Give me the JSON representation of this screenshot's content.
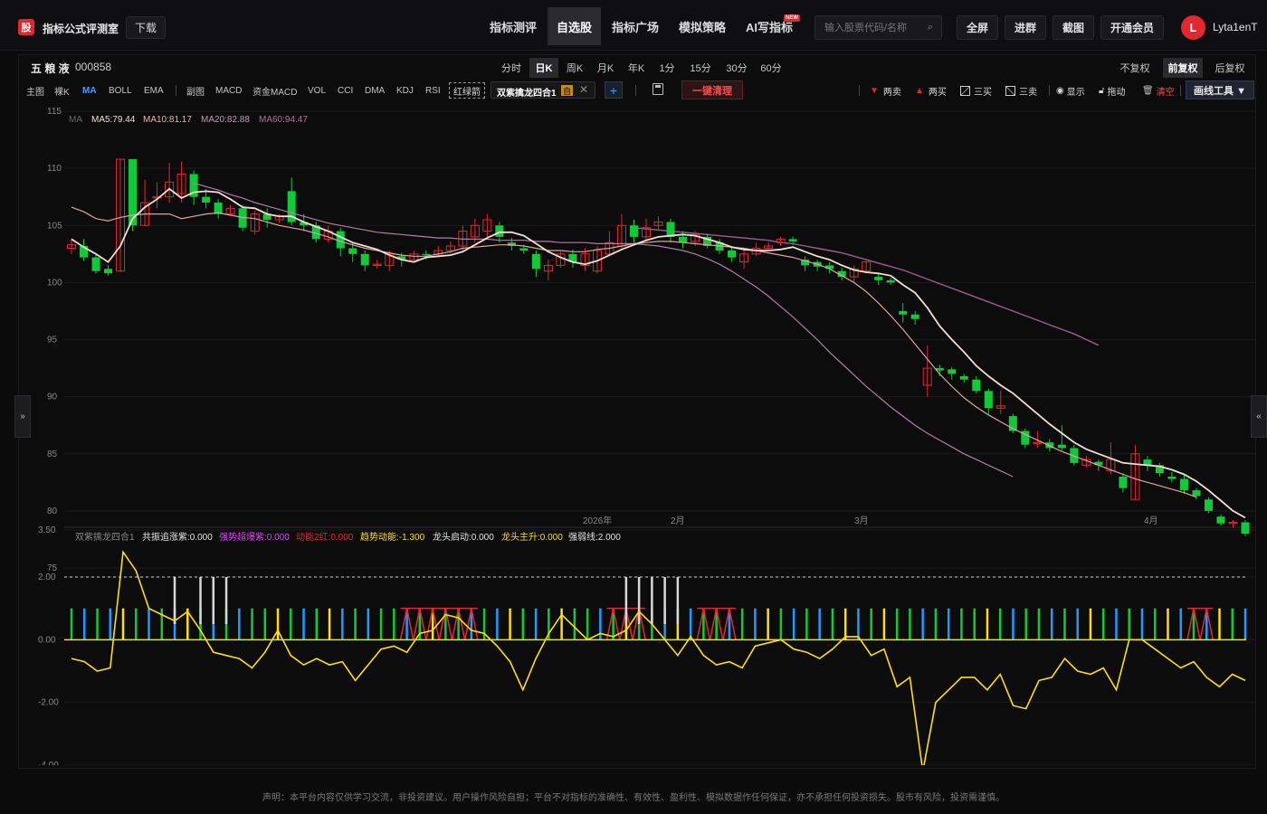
{
  "app": {
    "logo_char": "股",
    "name": "指标公式评测室",
    "download_label": "下载"
  },
  "nav": [
    {
      "label": "指标测评",
      "active": false
    },
    {
      "label": "自选股",
      "active": true
    },
    {
      "label": "指标广场",
      "active": false
    },
    {
      "label": "模拟策略",
      "active": false
    },
    {
      "label": "AI写指标",
      "active": false,
      "badge": "NEW"
    }
  ],
  "search": {
    "placeholder": "输入股票代码/名称",
    "value": ""
  },
  "top_buttons": [
    "全屏",
    "进群",
    "截图",
    "开通会员"
  ],
  "user": {
    "avatar_letter": "L",
    "name": "Lyta1enT"
  },
  "stock": {
    "name": "五 粮 液",
    "code": "000858"
  },
  "periods": [
    "分时",
    "日K",
    "周K",
    "月K",
    "年K",
    "1分",
    "15分",
    "30分",
    "60分"
  ],
  "active_period": "日K",
  "adjust": [
    "不复权",
    "前复权",
    "后复权"
  ],
  "active_adjust": "前复权",
  "main_tabs": [
    "主图",
    "裸K",
    "MA",
    "BOLL",
    "EMA"
  ],
  "sub_tabs": [
    "副图",
    "MACD",
    "资金MACD",
    "VOL",
    "CCI",
    "DMA",
    "KDJ",
    "RSI"
  ],
  "red_green_arrow": "红绿箭",
  "indicator_tag": {
    "name": "双紫擒龙四合1",
    "badge": "自"
  },
  "one_click_clear": "一键清理",
  "draw_options": [
    "两卖",
    "两买",
    "三买",
    "三卖",
    "显示",
    "拖动",
    "清空"
  ],
  "draw_tools_label": "画线工具 ▼",
  "ma_legend": {
    "label": "MA",
    "ma5": "MA5:79.44",
    "ma10": "MA10:81.17",
    "ma20": "MA20:82.88",
    "ma60": "MA60:94.47"
  },
  "sub_legend": {
    "name": "双紫擒龙四合1",
    "items": [
      "共振追涨紫:0.000",
      "强势超爆紫:0.000",
      "动能2红:0.000",
      "趋势动能:-1.300",
      "龙头启动:0.000",
      "龙头主升:0.000",
      "强弱线:2.000"
    ]
  },
  "time_labels": [
    "2026年",
    "2月",
    "3月",
    "4月"
  ],
  "disclaimer": "声明：本平台内容仅供学习交流，非投资建议。用户操作风险自担；平台不对指标的准确性、有效性、盈利性、模拟数据作任何保证，亦不承担任何投资损失。股市有风险，投资需谨慎。",
  "colors": {
    "up": "#e3262f",
    "down": "#12c93a",
    "ma5": "#f0ddd4",
    "ma10": "#d8a6a0",
    "ma20": "#b07ea2",
    "ma60": "#9a5f8c",
    "trend": "#ffe000",
    "accent": "#4a9cff"
  },
  "chart_data": [
    {
      "type": "candlestick",
      "y_ticks": [
        115,
        110,
        105,
        100,
        95,
        90,
        85,
        80,
        75
      ],
      "ylim": [
        75,
        115
      ],
      "x_labels": [
        "2026年",
        "2月",
        "3月",
        "4月"
      ],
      "candles": [
        [
          103.0,
          103.3,
          103.8,
          102.5
        ],
        [
          103.2,
          102.2,
          103.8,
          101.9
        ],
        [
          102.2,
          101.0,
          102.5,
          100.8
        ],
        [
          101.2,
          100.8,
          101.5,
          100.6
        ],
        [
          101.0,
          110.8,
          110.8,
          100.9
        ],
        [
          110.8,
          105.0,
          110.8,
          104.5
        ],
        [
          105.0,
          107.0,
          109.0,
          105.0
        ],
        [
          107.5,
          107.5,
          108.8,
          106.5
        ],
        [
          107.5,
          108.8,
          110.5,
          107.0
        ],
        [
          107.8,
          109.5,
          110.6,
          107.0
        ],
        [
          109.5,
          107.5,
          109.8,
          106.8
        ],
        [
          107.5,
          107.0,
          108.2,
          106.5
        ],
        [
          107.0,
          106.0,
          107.3,
          105.6
        ],
        [
          106.0,
          106.5,
          106.8,
          105.8
        ],
        [
          106.5,
          104.8,
          106.8,
          104.5
        ],
        [
          104.5,
          106.0,
          106.3,
          104.2
        ],
        [
          106.0,
          105.5,
          106.5,
          104.8
        ],
        [
          105.5,
          105.8,
          106.0,
          105.2
        ],
        [
          108.0,
          105.3,
          109.2,
          105.0
        ],
        [
          105.3,
          105.0,
          106.0,
          104.5
        ],
        [
          105.0,
          103.8,
          105.3,
          103.5
        ],
        [
          103.8,
          104.5,
          105.0,
          103.5
        ],
        [
          104.5,
          103.0,
          104.8,
          102.3
        ],
        [
          103.0,
          102.5,
          103.5,
          101.8
        ],
        [
          102.5,
          101.5,
          102.8,
          101.0
        ],
        [
          101.5,
          101.6,
          102.0,
          101.2
        ],
        [
          101.5,
          102.5,
          102.8,
          101.0
        ],
        [
          102.3,
          102.0,
          102.6,
          101.4
        ],
        [
          102.0,
          102.5,
          102.8,
          101.8
        ],
        [
          102.5,
          102.4,
          102.8,
          102.0
        ],
        [
          102.5,
          102.8,
          103.2,
          102.2
        ],
        [
          102.8,
          103.2,
          103.6,
          102.5
        ],
        [
          103.2,
          104.5,
          105.0,
          102.8
        ],
        [
          104.0,
          105.0,
          105.6,
          103.5
        ],
        [
          104.5,
          105.5,
          106.0,
          104.0
        ],
        [
          105.0,
          104.0,
          105.3,
          103.5
        ],
        [
          103.5,
          103.2,
          103.9,
          102.8
        ],
        [
          103.0,
          102.8,
          103.3,
          102.5
        ],
        [
          102.5,
          101.2,
          102.8,
          100.5
        ],
        [
          101.0,
          101.5,
          102.0,
          100.2
        ],
        [
          101.5,
          102.5,
          102.7,
          101.3
        ],
        [
          102.5,
          101.8,
          102.9,
          101.3
        ],
        [
          101.5,
          102.5,
          103.0,
          101.0
        ],
        [
          101.0,
          102.8,
          103.2,
          100.8
        ],
        [
          102.5,
          103.5,
          104.5,
          102.3
        ],
        [
          103.2,
          105.0,
          106.0,
          103.0
        ],
        [
          105.0,
          104.0,
          105.5,
          103.5
        ],
        [
          104.0,
          104.8,
          105.6,
          103.6
        ],
        [
          105.0,
          105.3,
          105.8,
          104.5
        ],
        [
          105.3,
          104.0,
          105.6,
          103.5
        ],
        [
          104.0,
          103.5,
          104.5,
          103.0
        ],
        [
          103.6,
          104.2,
          104.5,
          103.2
        ],
        [
          104.0,
          103.2,
          104.3,
          103.0
        ],
        [
          103.5,
          102.8,
          103.8,
          102.5
        ],
        [
          102.8,
          102.2,
          103.2,
          101.8
        ],
        [
          101.8,
          102.5,
          103.0,
          101.2
        ],
        [
          102.5,
          103.0,
          103.5,
          102.3
        ],
        [
          103.0,
          103.2,
          103.5,
          102.8
        ],
        [
          103.5,
          103.8,
          104.0,
          103.2
        ],
        [
          103.8,
          103.6,
          104.0,
          103.3
        ],
        [
          102.0,
          101.5,
          102.3,
          101.0
        ],
        [
          101.8,
          101.4,
          102.0,
          101.0
        ],
        [
          101.5,
          101.2,
          101.8,
          100.8
        ],
        [
          101.0,
          100.5,
          101.3,
          100.2
        ],
        [
          100.5,
          101.2,
          101.5,
          100.0
        ],
        [
          101.0,
          101.8,
          102.0,
          100.8
        ],
        [
          100.5,
          100.2,
          100.8,
          99.8
        ],
        [
          100.2,
          100.0,
          100.4,
          99.8
        ],
        [
          97.5,
          97.2,
          98.2,
          96.5
        ],
        [
          97.2,
          96.8,
          97.5,
          96.3
        ],
        [
          91.0,
          92.5,
          94.5,
          90.0
        ],
        [
          92.5,
          92.3,
          92.8,
          91.8
        ],
        [
          92.4,
          92.0,
          92.6,
          91.5
        ],
        [
          91.8,
          91.5,
          92.0,
          91.2
        ],
        [
          91.5,
          90.5,
          91.8,
          90.3
        ],
        [
          90.5,
          89.0,
          90.7,
          88.5
        ],
        [
          89.0,
          89.2,
          90.5,
          88.5
        ],
        [
          88.3,
          87.0,
          88.5,
          86.8
        ],
        [
          87.0,
          85.8,
          87.2,
          85.5
        ],
        [
          86.0,
          86.0,
          87.0,
          85.5
        ],
        [
          86.0,
          85.5,
          86.3,
          85.2
        ],
        [
          85.8,
          85.5,
          87.5,
          85.3
        ],
        [
          85.5,
          84.2,
          85.8,
          84.0
        ],
        [
          84.0,
          84.5,
          84.8,
          83.8
        ],
        [
          84.3,
          84.0,
          84.5,
          83.5
        ],
        [
          83.5,
          84.5,
          86.0,
          83.2
        ],
        [
          83.0,
          82.0,
          83.3,
          81.6
        ],
        [
          81.0,
          85.0,
          85.8,
          81.0
        ],
        [
          84.5,
          84.0,
          84.8,
          83.5
        ],
        [
          84.0,
          83.3,
          84.2,
          83.0
        ],
        [
          83.0,
          82.8,
          83.4,
          82.5
        ],
        [
          82.8,
          81.8,
          83.2,
          81.5
        ],
        [
          81.8,
          81.3,
          82.0,
          81.0
        ],
        [
          81.0,
          80.0,
          81.2,
          79.8
        ],
        [
          79.5,
          78.9,
          79.7,
          78.7
        ],
        [
          78.9,
          79.0,
          79.2,
          78.5
        ],
        [
          79.0,
          78.0,
          79.2,
          77.8
        ]
      ],
      "ma5": [
        103.8,
        103.1,
        102.5,
        101.8,
        103.2,
        105.6,
        106.6,
        107.3,
        108.2,
        107.4,
        107.9,
        108.0,
        107.9,
        107.3,
        106.6,
        106.5,
        106.0,
        105.8,
        105.8,
        105.3,
        104.9,
        104.5,
        104.0,
        103.5,
        103.2,
        102.9,
        102.4,
        102.0,
        101.8,
        102.2,
        102.3,
        102.4,
        102.7,
        103.3,
        103.9,
        104.4,
        104.4,
        104.1,
        103.4,
        102.7,
        102.2,
        101.8,
        101.6,
        101.9,
        102.4,
        102.9,
        103.3,
        103.7,
        104.0,
        104.1,
        104.2,
        104.1,
        103.8,
        103.5,
        103.1,
        102.9,
        102.8,
        102.8,
        102.9,
        103.1,
        102.7,
        102.3,
        102.0,
        101.5,
        101.1,
        100.9,
        100.8,
        100.6,
        99.8,
        99.1,
        97.8,
        96.2,
        95.0,
        93.9,
        92.7,
        91.8,
        91.0,
        90.3,
        89.4,
        88.5,
        87.6,
        86.8,
        86.0,
        85.4,
        85.0,
        84.6,
        84.2,
        84.1,
        84.0,
        83.9,
        83.6,
        83.2,
        82.6,
        81.8,
        80.9,
        80.0,
        79.4
      ],
      "ma10": [
        106.6,
        106.2,
        105.6,
        105.4,
        105.7,
        105.9,
        106.0,
        106.0,
        106.0,
        105.6,
        105.8,
        106.0,
        106.1,
        105.9,
        105.7,
        105.6,
        105.3,
        105.0,
        104.8,
        104.6,
        104.3,
        104.0,
        103.6,
        103.3,
        103.0,
        102.8,
        102.6,
        102.4,
        102.3,
        102.3,
        102.5,
        102.7,
        103.0,
        103.1,
        103.2,
        103.3,
        103.3,
        103.2,
        103.0,
        102.8,
        102.8,
        102.7,
        102.7,
        102.9,
        103.0,
        103.2,
        103.4,
        103.5,
        103.6,
        103.6,
        103.5,
        103.4,
        103.3,
        103.2,
        103.1,
        103.0,
        102.8,
        102.6,
        102.4,
        102.2,
        101.9,
        101.6,
        101.2,
        100.6,
        100.0,
        99.2,
        98.2,
        97.1,
        95.9,
        94.6,
        93.3,
        92.0,
        90.9,
        89.9,
        89.1,
        88.4,
        87.8,
        87.2,
        86.7,
        86.2,
        85.7,
        85.2,
        84.8,
        84.4,
        84.0,
        83.6,
        83.2,
        82.8,
        82.5,
        82.2,
        81.9,
        81.6,
        81.2
      ],
      "ma20": [
        null,
        null,
        null,
        null,
        null,
        null,
        null,
        null,
        null,
        null,
        108.7,
        108.4,
        108.1,
        107.7,
        107.4,
        107.0,
        106.7,
        106.4,
        106.1,
        105.8,
        105.5,
        105.2,
        105.0,
        104.8,
        104.6,
        104.4,
        104.3,
        104.2,
        104.1,
        104.0,
        103.9,
        103.9,
        103.8,
        103.8,
        103.8,
        103.7,
        103.7,
        103.7,
        103.6,
        103.6,
        103.5,
        103.5,
        103.5,
        103.4,
        103.4,
        103.4,
        103.4,
        103.3,
        103.2,
        103.0,
        102.8,
        102.5,
        102.1,
        101.6,
        101.0,
        100.3,
        99.6,
        98.8,
        97.9,
        97.0,
        96.0,
        95.0,
        93.9,
        92.9,
        91.9,
        90.9,
        90.0,
        89.1,
        88.3,
        87.5,
        86.8,
        86.2,
        85.6,
        85.0,
        84.5,
        84.0,
        83.5,
        83.0
      ],
      "ma60": [
        null,
        null,
        null,
        null,
        null,
        null,
        null,
        null,
        null,
        null,
        null,
        null,
        null,
        null,
        null,
        null,
        null,
        null,
        null,
        null,
        null,
        null,
        null,
        null,
        null,
        null,
        null,
        null,
        null,
        null,
        null,
        null,
        null,
        null,
        null,
        null,
        null,
        null,
        null,
        null,
        null,
        null,
        null,
        null,
        null,
        null,
        104.8,
        104.7,
        104.6,
        104.5,
        104.4,
        104.3,
        104.2,
        104.1,
        104.0,
        103.9,
        103.8,
        103.7,
        103.5,
        103.4,
        103.2,
        103.0,
        102.8,
        102.6,
        102.3,
        102.0,
        101.7,
        101.4,
        101.1,
        100.7,
        100.3,
        99.9,
        99.5,
        99.1,
        98.7,
        98.3,
        97.9,
        97.5,
        97.1,
        96.7,
        96.3,
        95.9,
        95.5,
        95.0,
        94.5
      ]
    },
    {
      "type": "bar+line",
      "y_ticks": [
        3.5,
        2.0,
        0.0,
        -2.0,
        -4.0,
        -5.5
      ],
      "ylim": [
        -5.5,
        3.5
      ],
      "dashed_line": 2.0,
      "bar_height": 1.0,
      "bars_color_cycle": [
        "#12c93a",
        "#1e9bff",
        "#12c93a",
        "#1e9bff",
        "#12c93a"
      ],
      "yellow_bar_indices": [
        4,
        9,
        16,
        20,
        28,
        34,
        38,
        43,
        47,
        54,
        60,
        63,
        71,
        79,
        85,
        89,
        93
      ],
      "red_box_ranges": [
        [
          26,
          31
        ],
        [
          42,
          44
        ],
        [
          49,
          51
        ],
        [
          87,
          88
        ]
      ],
      "white_bar_indices": [
        [
          8,
          0.5
        ],
        [
          10,
          0.5
        ],
        [
          11,
          0.5
        ],
        [
          12,
          0.5
        ],
        [
          43,
          0.5
        ],
        [
          44,
          0.5
        ],
        [
          45,
          0.5
        ],
        [
          46,
          0.5
        ],
        [
          47,
          0.5
        ]
      ],
      "trend": [
        -0.6,
        -0.7,
        -1.0,
        -0.9,
        2.8,
        2.2,
        1.0,
        0.8,
        0.6,
        0.9,
        0.3,
        -0.4,
        -0.5,
        -0.6,
        -0.9,
        -0.4,
        0.3,
        -0.5,
        -0.8,
        -0.6,
        -0.8,
        -0.7,
        -1.3,
        -0.8,
        -0.3,
        -0.2,
        -0.4,
        0.2,
        0.3,
        0.8,
        0.7,
        0.3,
        0.2,
        -0.2,
        -0.7,
        -1.6,
        -0.6,
        0.2,
        0.8,
        0.4,
        0.0,
        0.2,
        0.1,
        0.3,
        0.9,
        0.5,
        0.0,
        -0.5,
        0.1,
        -0.5,
        -0.8,
        -0.7,
        -0.9,
        -0.2,
        -0.1,
        0.0,
        -0.3,
        -0.4,
        -0.6,
        -0.3,
        0.1,
        0.1,
        -0.5,
        -0.3,
        -1.5,
        -1.2,
        -4.2,
        -2.0,
        -1.6,
        -1.2,
        -1.2,
        -1.6,
        -1.1,
        -2.1,
        -2.2,
        -1.3,
        -1.2,
        -0.6,
        -1.0,
        -1.1,
        -0.9,
        -1.6,
        0.0,
        0.0,
        -0.3,
        -0.6,
        -0.9,
        -0.7,
        -1.2,
        -1.5,
        -1.1,
        -1.3
      ]
    }
  ]
}
